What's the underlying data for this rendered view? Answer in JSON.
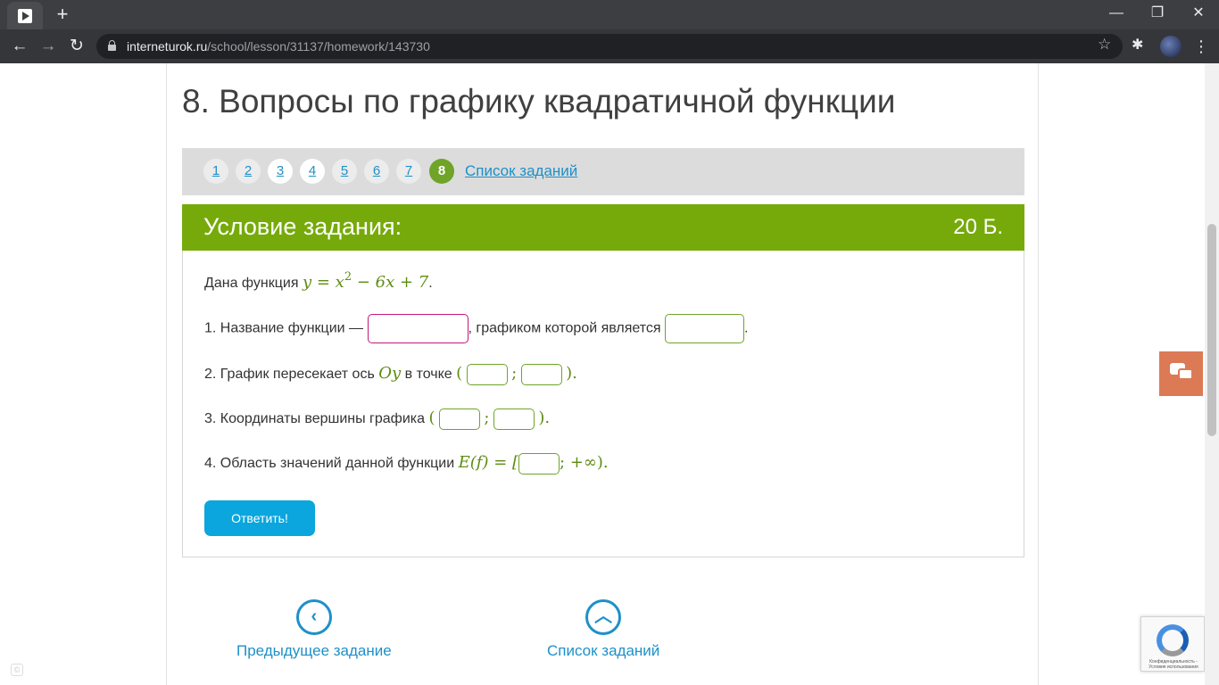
{
  "browser": {
    "url_host": "interneturok.ru",
    "url_path": "/school/lesson/31137/homework/143730",
    "new_tab_label": "+",
    "minimize_label": "—",
    "restore_label": "❐",
    "close_label": "✕"
  },
  "page": {
    "title": "8. Вопросы по графику квадратичной функции",
    "pager": {
      "pages": [
        "1",
        "2",
        "3",
        "4",
        "5",
        "6",
        "7",
        "8"
      ],
      "active_page": "8",
      "task_list_link": "Список заданий"
    }
  },
  "task": {
    "header_title": "Условие задания:",
    "points": "20 Б.",
    "intro_text": "Дана функция",
    "function_lhs": "y = x",
    "function_exp": "2",
    "function_rhs": "− 6x + 7",
    "q1_prefix": "1. Название функции —",
    "q1_middle": ", графиком которой является",
    "q2_prefix": "2. График пересекает ось",
    "q2_axis": "Oy",
    "q2_middle": "в точке",
    "q3_prefix": "3. Координаты вершины графика",
    "q4_prefix": "4. Область значений данной функции",
    "q4_expr": "E(f) = [",
    "q4_tail": "; +∞).",
    "open_paren": "(",
    "close_paren": ").",
    "semicolon": ";",
    "period": ".",
    "submit_label": "Ответить!"
  },
  "navigation": {
    "prev_label": "Предыдущее задание",
    "list_label": "Список заданий"
  },
  "recaptcha": {
    "text": "Конфиденциальность - Условия использования"
  },
  "colors": {
    "accent_green": "#76aa0a",
    "link_blue": "#1e90c8",
    "submit_blue": "#0aa6dd",
    "chat_orange": "#dc7a55"
  }
}
